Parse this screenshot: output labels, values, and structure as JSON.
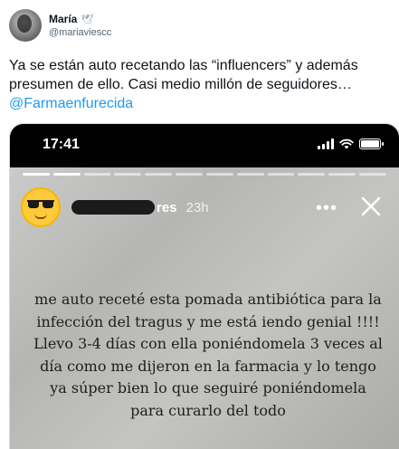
{
  "tweet": {
    "display_name": "María",
    "name_glyph": "🕊",
    "handle": "@mariaviescc",
    "text": "Ya se están auto recetando las “influencers” y además presumen de ello. Casi medio millón de seguidores…",
    "mention": "@Farmaenfurecida"
  },
  "story": {
    "status_time": "17:41",
    "username_suffix": "res",
    "posted_ago": "23h",
    "more_glyph": "•••",
    "progress_segments_total": 12,
    "progress_segments_done": 2,
    "battery_level": 1.0,
    "caption": "me auto receté esta pomada antibiótica para la infección del tragus y me está iendo genial !!!! Llevo 3-4 días con ella poniéndomela 3 veces al día como me dijeron en la farmacia y lo tengo ya súper bien lo que seguiré poniéndomela para curarlo del todo"
  },
  "colors": {
    "link": "#1d9bf0",
    "text_primary": "#0f1419",
    "text_secondary": "#536471"
  },
  "icons": [
    "avatar",
    "dove-icon",
    "signal-icon",
    "wifi-icon",
    "battery-icon",
    "sunglasses-emoji-avatar",
    "more-icon",
    "close-icon"
  ]
}
